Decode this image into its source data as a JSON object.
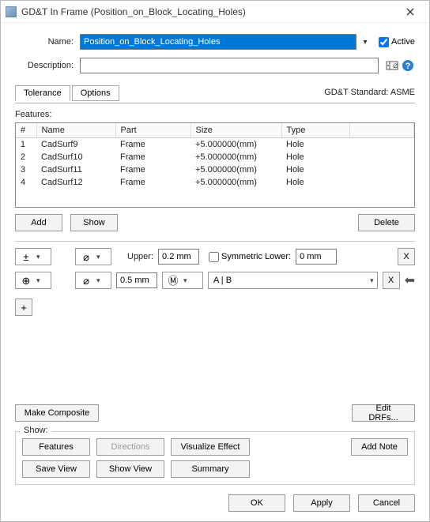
{
  "window": {
    "title": "GD&T In Frame (Position_on_Block_Locating_Holes)"
  },
  "form": {
    "name_label": "Name:",
    "name_value": "Position_on_Block_Locating_Holes",
    "desc_label": "Description:",
    "desc_value": "",
    "active_label": "Active",
    "active_checked": true
  },
  "tabs": {
    "tab0": "Tolerance",
    "tab1": "Options"
  },
  "standard": "GD&T Standard: ASME",
  "features": {
    "heading": "Features:",
    "cols": {
      "num": "#",
      "name": "Name",
      "part": "Part",
      "size": "Size",
      "type": "Type"
    },
    "rows": [
      {
        "n": "1",
        "name": "CadSurf9",
        "part": "Frame",
        "size": "+5.000000(mm)",
        "type": "Hole"
      },
      {
        "n": "2",
        "name": "CadSurf10",
        "part": "Frame",
        "size": "+5.000000(mm)",
        "type": "Hole"
      },
      {
        "n": "3",
        "name": "CadSurf11",
        "part": "Frame",
        "size": "+5.000000(mm)",
        "type": "Hole"
      },
      {
        "n": "4",
        "name": "CadSurf12",
        "part": "Frame",
        "size": "+5.000000(mm)",
        "type": "Hole"
      }
    ],
    "add": "Add",
    "show": "Show",
    "delete": "Delete"
  },
  "tolerance": {
    "row1": {
      "sym": "±",
      "mod": "⌀",
      "upper_label": "Upper:",
      "upper_value": "0.2 mm",
      "symlower_label": "Symmetric Lower:",
      "symlower_checked": false,
      "lower_value": "0 mm",
      "x": "X"
    },
    "row2": {
      "sym": "⊕",
      "mod": "⌀",
      "value": "0.5 mm",
      "matmod": "Ⓜ",
      "datum": "A | B",
      "x": "X"
    },
    "plus": "+",
    "make_composite": "Make Composite",
    "edit_drfs": "Edit DRFs..."
  },
  "show_group": {
    "legend": "Show:",
    "features": "Features",
    "directions": "Directions",
    "visualize": "Visualize Effect",
    "addnote": "Add Note",
    "saveview": "Save View",
    "showview": "Show View",
    "summary": "Summary"
  },
  "dialog": {
    "ok": "OK",
    "apply": "Apply",
    "cancel": "Cancel"
  }
}
